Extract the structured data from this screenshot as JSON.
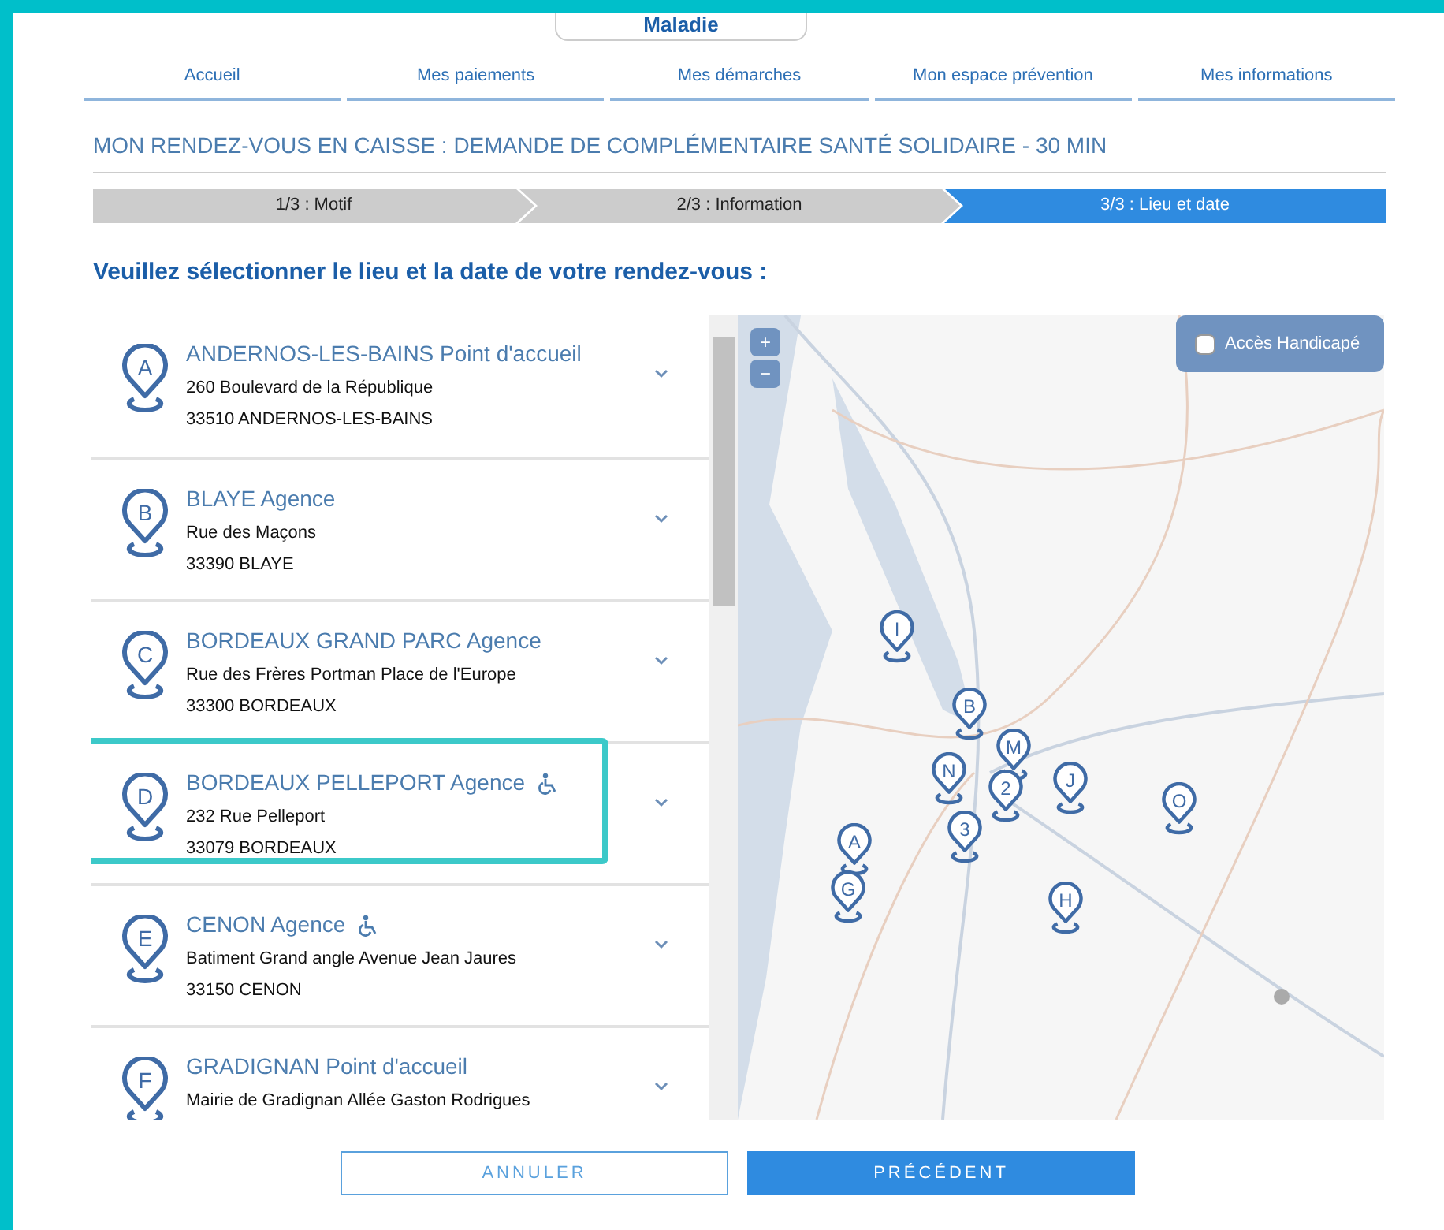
{
  "logo": {
    "text": "Maladie"
  },
  "nav": [
    {
      "label": "Accueil"
    },
    {
      "label": "Mes paiements"
    },
    {
      "label": "Mes démarches"
    },
    {
      "label": "Mon espace prévention"
    },
    {
      "label": "Mes informations"
    }
  ],
  "page_title": "MON RENDEZ-VOUS EN CAISSE : DEMANDE DE COMPLÉMENTAIRE SANTÉ SOLIDAIRE - 30 MIN",
  "steps": [
    {
      "label": "1/3 : Motif",
      "selected": false
    },
    {
      "label": "2/3 : Information",
      "selected": false
    },
    {
      "label": "3/3 : Lieu et date",
      "selected": true
    }
  ],
  "heading": "Veuillez sélectionner le lieu et la date de votre rendez-vous :",
  "locations": [
    {
      "letter": "A",
      "name": "ANDERNOS-LES-BAINS Point d'accueil",
      "address": "260 Boulevard de la République",
      "city": "33510 ANDERNOS-LES-BAINS",
      "accessible": false,
      "highlighted": false
    },
    {
      "letter": "B",
      "name": "BLAYE Agence",
      "address": "Rue des Maçons",
      "city": "33390 BLAYE",
      "accessible": false,
      "highlighted": false
    },
    {
      "letter": "C",
      "name": "BORDEAUX GRAND PARC Agence",
      "address": "Rue des Frères Portman Place de l'Europe",
      "city": "33300 BORDEAUX",
      "accessible": false,
      "highlighted": false
    },
    {
      "letter": "D",
      "name": "BORDEAUX PELLEPORT Agence",
      "address": "232 Rue Pelleport",
      "city": "33079 BORDEAUX",
      "accessible": true,
      "highlighted": true
    },
    {
      "letter": "E",
      "name": "CENON Agence",
      "address": "Batiment Grand angle Avenue Jean Jaures",
      "city": "33150 CENON",
      "accessible": true,
      "highlighted": false
    },
    {
      "letter": "F",
      "name": "GRADIGNAN Point d'accueil",
      "address": "Mairie de Gradignan Allée Gaston Rodrigues",
      "accessible": false,
      "highlighted": false
    }
  ],
  "map": {
    "zoom_in": "+",
    "zoom_out": "−",
    "filter": {
      "label": "Accès Handicapé",
      "checked": false
    },
    "pins": [
      {
        "label": "I"
      },
      {
        "label": "B"
      },
      {
        "label": "M"
      },
      {
        "label": "N"
      },
      {
        "label": "2"
      },
      {
        "label": "3"
      },
      {
        "label": "J"
      },
      {
        "label": "O"
      },
      {
        "label": "A"
      },
      {
        "label": "G"
      },
      {
        "label": "H"
      }
    ]
  },
  "buttons": [
    {
      "label": "ANNULER",
      "kind": "secondary"
    },
    {
      "label": "PRÉCÉDENT",
      "kind": "primary"
    }
  ]
}
